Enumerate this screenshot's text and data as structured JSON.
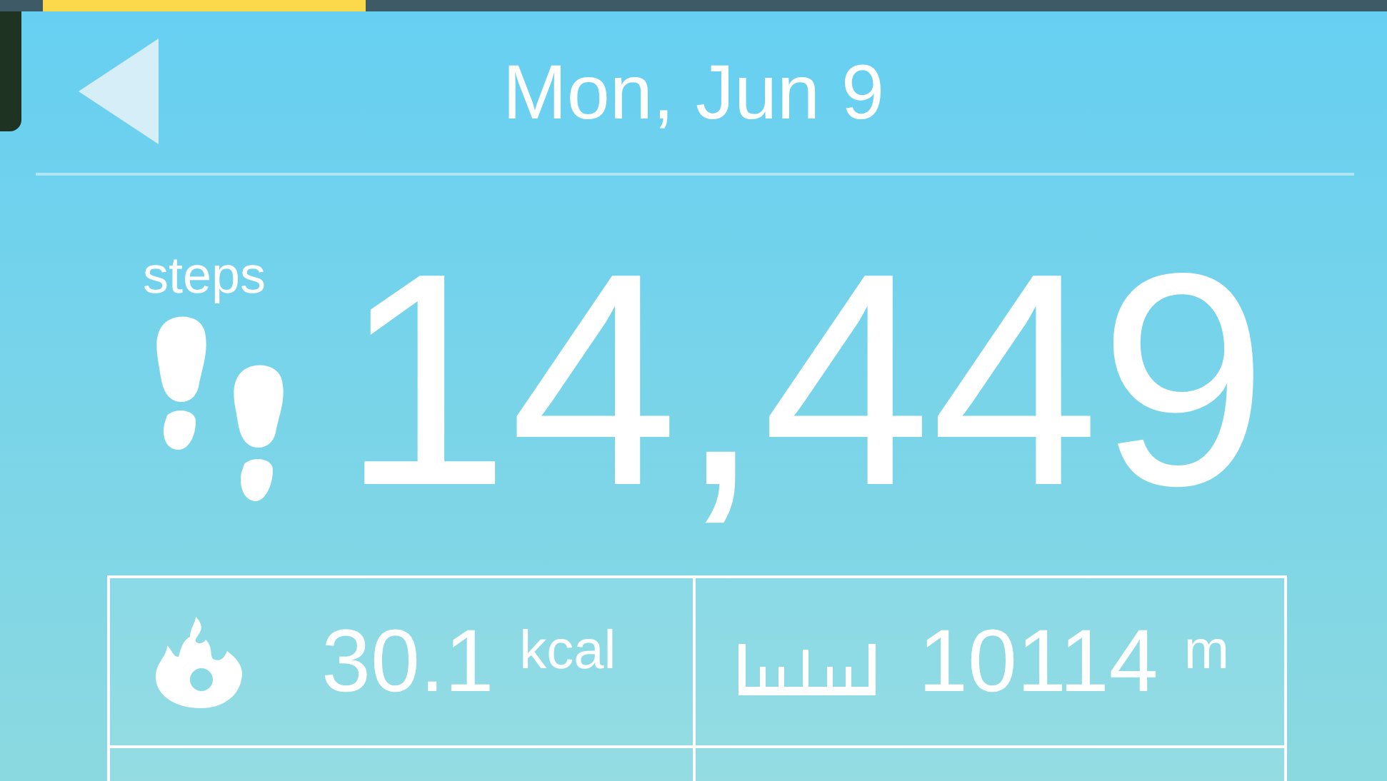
{
  "progress": {
    "level": 0.24
  },
  "header": {
    "title": "Mon, Jun 9"
  },
  "steps": {
    "label": "steps",
    "value": "14,449"
  },
  "stats": [
    {
      "kind": "calories",
      "value": "30.1",
      "unit": "kcal"
    },
    {
      "kind": "distance",
      "value": "10114",
      "unit": "m"
    }
  ]
}
